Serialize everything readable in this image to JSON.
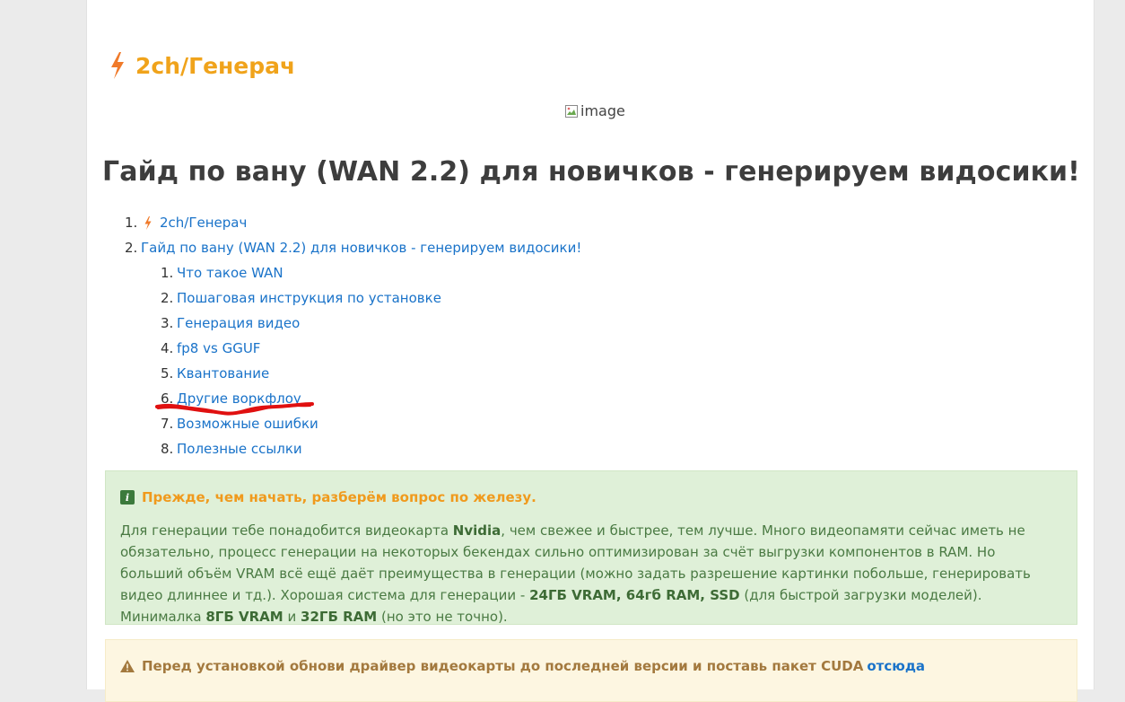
{
  "brand": {
    "title": "2ch/Генерач",
    "icon": "lightning-bolt-icon"
  },
  "image": {
    "alt": "image"
  },
  "article": {
    "title": "Гайд по вану (WAN 2.2) для новичков - генерируем видосики!"
  },
  "toc": {
    "items": [
      {
        "num": "1.",
        "label": "2ch/Генерач"
      },
      {
        "num": "2.",
        "label": "Гайд по вану (WAN 2.2) для новичков - генерируем видосики!"
      }
    ],
    "subitems": [
      {
        "num": "1.",
        "label": "Что такое WAN"
      },
      {
        "num": "2.",
        "label": "Пошаговая инструкция по установке"
      },
      {
        "num": "3.",
        "label": "Генерация видео"
      },
      {
        "num": "4.",
        "label": "fp8 vs GGUF"
      },
      {
        "num": "5.",
        "label": "Квантование"
      },
      {
        "num": "6.",
        "label": "Другие воркфлоу"
      },
      {
        "num": "7.",
        "label": "Возможные ошибки"
      },
      {
        "num": "8.",
        "label": "Полезные ссылки"
      }
    ]
  },
  "info_alert": {
    "icon_glyph": "i",
    "heading": "Прежде, чем начать, разберём вопрос по железу.",
    "t1": "Для генерации тебе понадобится видеокарта ",
    "b1": "Nvidia",
    "t2": ", чем свежее и быстрее, тем лучше. Много видеопамяти сейчас иметь не обязательно, процесс генерации на некоторых бекендах сильно оптимизирован за счёт выгрузки компонентов в RAM. Но больший объём VRAM всё ещё даёт преимущества в генерации (можно задать разрешение картинки побольше, генерировать видео длиннее и тд.). Хорошая система для генерации - ",
    "b2": "24ГБ VRAM, 64гб RAM, SSD",
    "t3": " (для быстрой загрузки моделей). Минималка ",
    "b3": "8ГБ VRAM",
    "t4": " и ",
    "b4": "32ГБ RAM",
    "t5": " (но это не точно)."
  },
  "warn_alert": {
    "icon": "warning-triangle-icon",
    "heading": "Перед установкой обнови драйвер видеокарты до последней версии и поставь пакет CUDA",
    "link": "отсюда"
  },
  "colors": {
    "brand_orange": "#f0a31b",
    "link_blue": "#1a73c9",
    "annotation_red": "#e01010",
    "info_bg": "#dff0d8",
    "warn_bg": "#fdf6e1"
  }
}
